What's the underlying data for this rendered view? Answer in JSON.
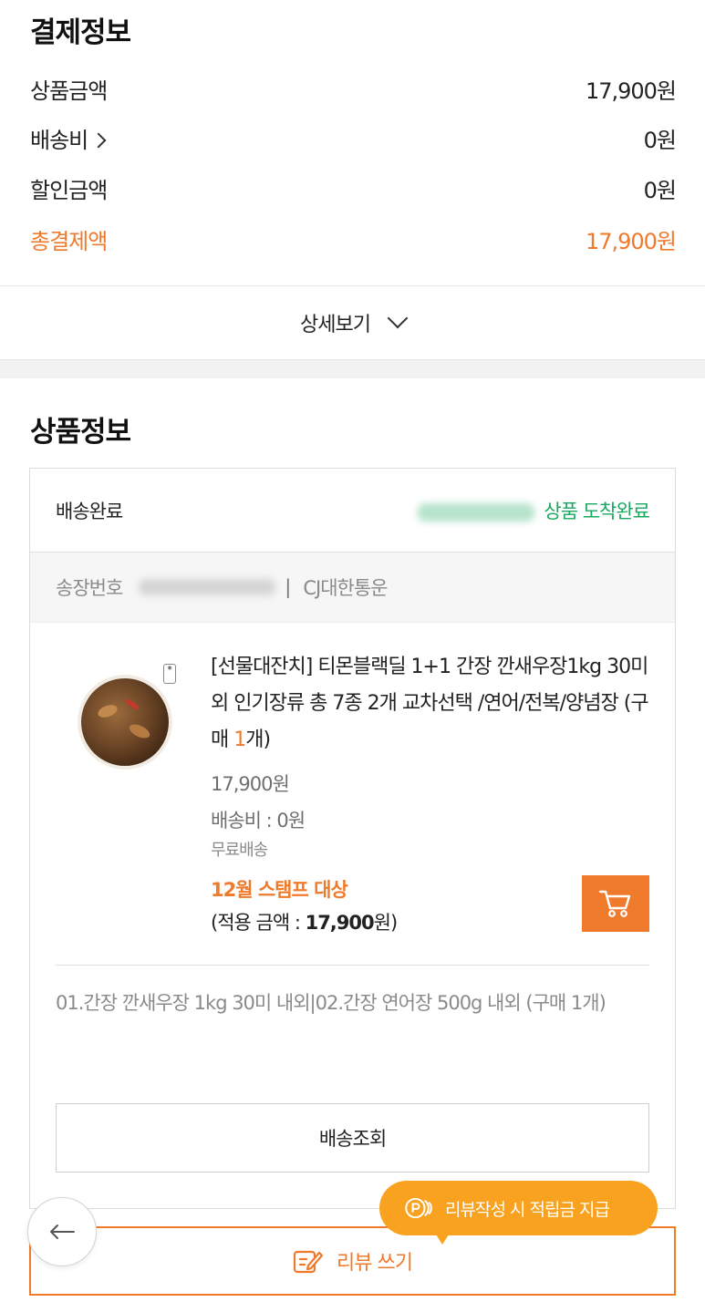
{
  "payment": {
    "title": "결제정보",
    "product_amount_label": "상품금액",
    "product_amount_value": "17,900원",
    "shipping_label": "배송비",
    "shipping_value": "0원",
    "discount_label": "할인금액",
    "discount_value": "0원",
    "total_label": "총결제액",
    "total_value": "17,900원",
    "detail_toggle": "상세보기"
  },
  "product_section": {
    "title": "상품정보",
    "status_label": "배송완료",
    "arrival_text": "상품 도착완료",
    "invoice_label": "송장번호",
    "carrier": "CJ대한통운",
    "product": {
      "name_main": "[선물대잔치] 티몬블랙딜 1+1 간장 깐새우장1kg 30미 외 인기장류 총 7종 2개 교차선택 /연어/전복/양념장 (구매 ",
      "qty_num": "1",
      "qty_suffix": "개)",
      "price": "17,900원",
      "shipping_fee": "배송비 : 0원",
      "free_shipping": "무료배송",
      "stamp_event": "12월 스탬프 대상",
      "applied_prefix": "(적용 금액 : ",
      "applied_amount": "17,900",
      "applied_suffix": "원)"
    },
    "option_text": "01.간장 깐새우장 1kg 30미 내외|02.간장 연어장 500g 내외 (구매 1개)",
    "track_button": "배송조회"
  },
  "review": {
    "tooltip": "리뷰작성 시 적립금 지급",
    "button": "리뷰 쓰기"
  },
  "icons": {
    "cart": "cart-icon",
    "back": "arrow-left-icon",
    "point": "point-coin-icon",
    "write": "pencil-write-icon"
  },
  "colors": {
    "accent": "#f07a2b",
    "arrival_green": "#1aa75f",
    "tooltip_bg": "#f9a21f"
  }
}
